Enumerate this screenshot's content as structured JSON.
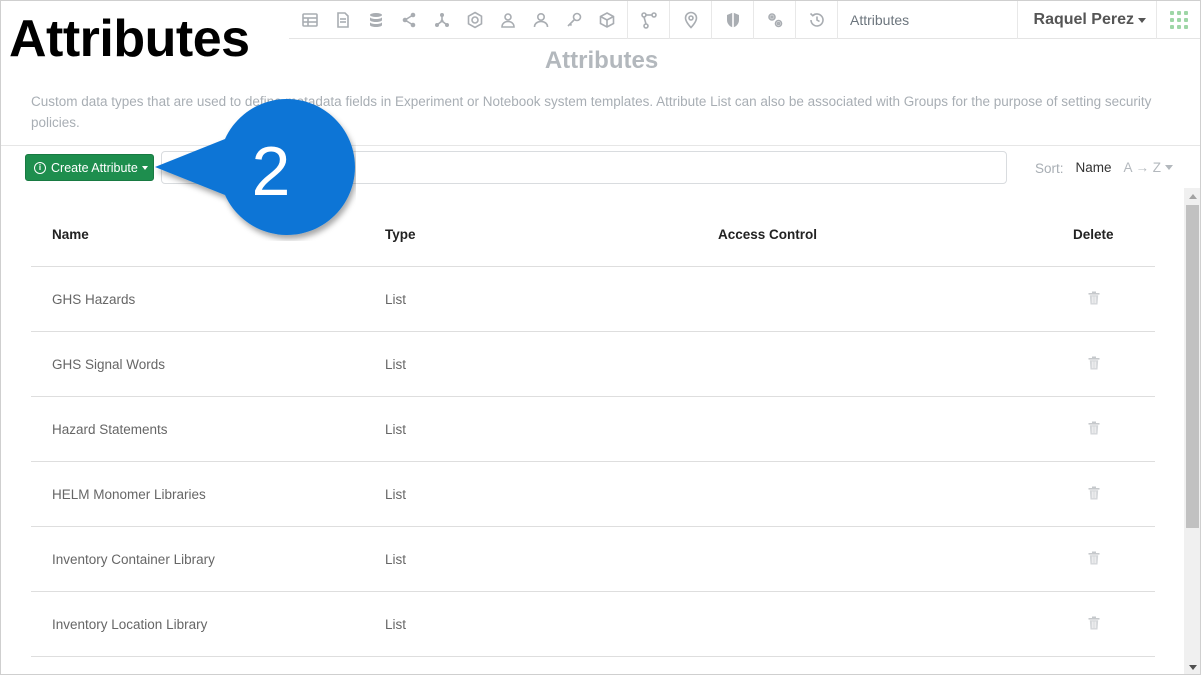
{
  "overlay_heading": "Attributes",
  "topbar": {
    "icons": [
      {
        "name": "table-icon"
      },
      {
        "name": "document-icon"
      },
      {
        "name": "database-icon"
      },
      {
        "name": "share-icon"
      },
      {
        "name": "network-icon"
      },
      {
        "name": "hexagon-icon"
      },
      {
        "name": "users-icon"
      },
      {
        "name": "user-icon"
      },
      {
        "name": "key-icon"
      },
      {
        "name": "cube-icon"
      },
      {
        "name": "workflow-icon"
      },
      {
        "name": "location-pin-icon"
      },
      {
        "name": "shield-icon"
      },
      {
        "name": "gears-icon"
      },
      {
        "name": "history-icon"
      }
    ],
    "section_title": "Attributes",
    "user_name": "Raquel Perez",
    "apps_icon": "apps-grid-icon"
  },
  "page": {
    "title": "Attributes",
    "description": "Custom data types that are used to define metadata fields in Experiment or Notebook system templates. Attribute List can also be associated with Groups for the purpose of setting security policies."
  },
  "toolbar": {
    "create_button_label": "Create Attribute",
    "search_value": "",
    "search_placeholder": "",
    "sort_label": "Sort:",
    "sort_field": "Name",
    "sort_order": "A → Z"
  },
  "table": {
    "columns": [
      "Name",
      "Type",
      "Access Control",
      "Delete"
    ],
    "rows": [
      {
        "name": "GHS Hazards",
        "type": "List",
        "access_control": ""
      },
      {
        "name": "GHS Signal Words",
        "type": "List",
        "access_control": ""
      },
      {
        "name": "Hazard Statements",
        "type": "List",
        "access_control": ""
      },
      {
        "name": "HELM Monomer Libraries",
        "type": "List",
        "access_control": ""
      },
      {
        "name": "Inventory Container Library",
        "type": "List",
        "access_control": ""
      },
      {
        "name": "Inventory Location Library",
        "type": "List",
        "access_control": ""
      }
    ]
  },
  "callout": {
    "number": "2",
    "color": "#0a75d6"
  },
  "colors": {
    "accent_green": "#1e8e4e",
    "muted_text": "#a8aeb4",
    "callout_blue": "#0a75d6"
  }
}
